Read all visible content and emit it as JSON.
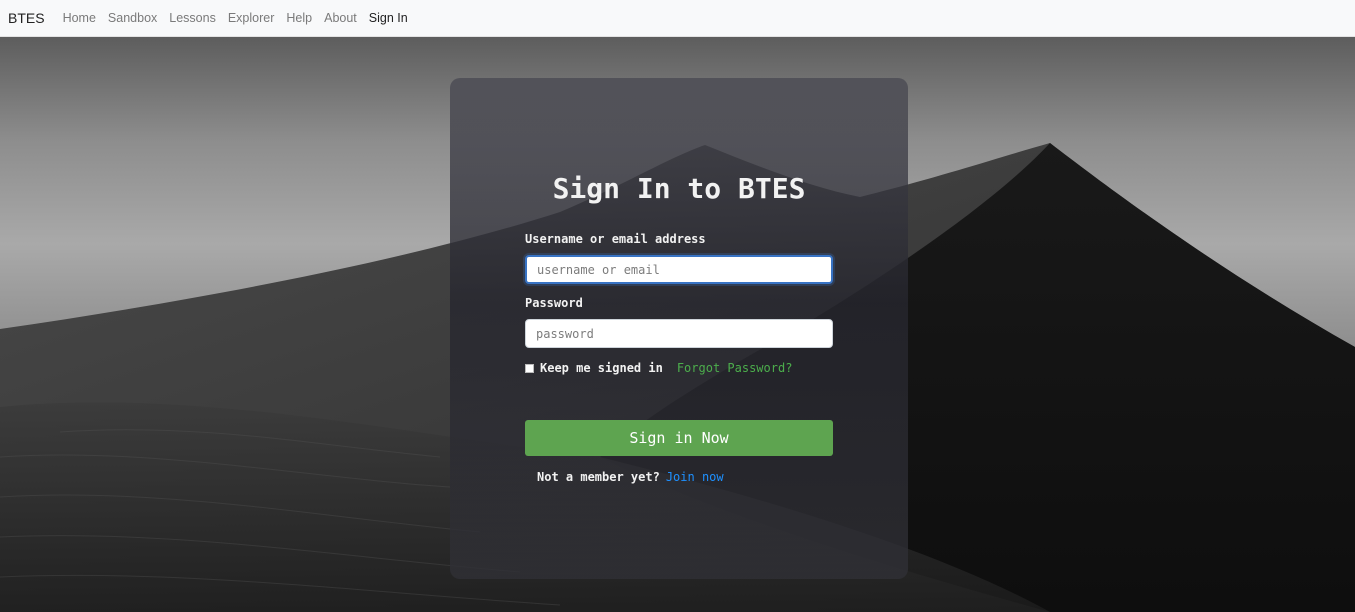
{
  "navbar": {
    "brand": "BTES",
    "links": [
      {
        "label": "Home"
      },
      {
        "label": "Sandbox"
      },
      {
        "label": "Lessons"
      },
      {
        "label": "Explorer"
      },
      {
        "label": "Help"
      },
      {
        "label": "About"
      },
      {
        "label": "Sign In",
        "active": true
      }
    ]
  },
  "signin": {
    "title": "Sign In to BTES",
    "username_label": "Username or email address",
    "username_placeholder": "username or email",
    "password_label": "Password",
    "password_placeholder": "password",
    "remember_label": "Keep me signed in",
    "forgot_label": "Forgot Password?",
    "submit_label": "Sign in Now",
    "member_prompt": "Not a member yet?",
    "join_label": "Join now"
  },
  "colors": {
    "submit_button": "#5ea450",
    "forgot_link": "#4cae4c",
    "join_link": "#1e90ff",
    "focus_border": "#3873c4"
  }
}
